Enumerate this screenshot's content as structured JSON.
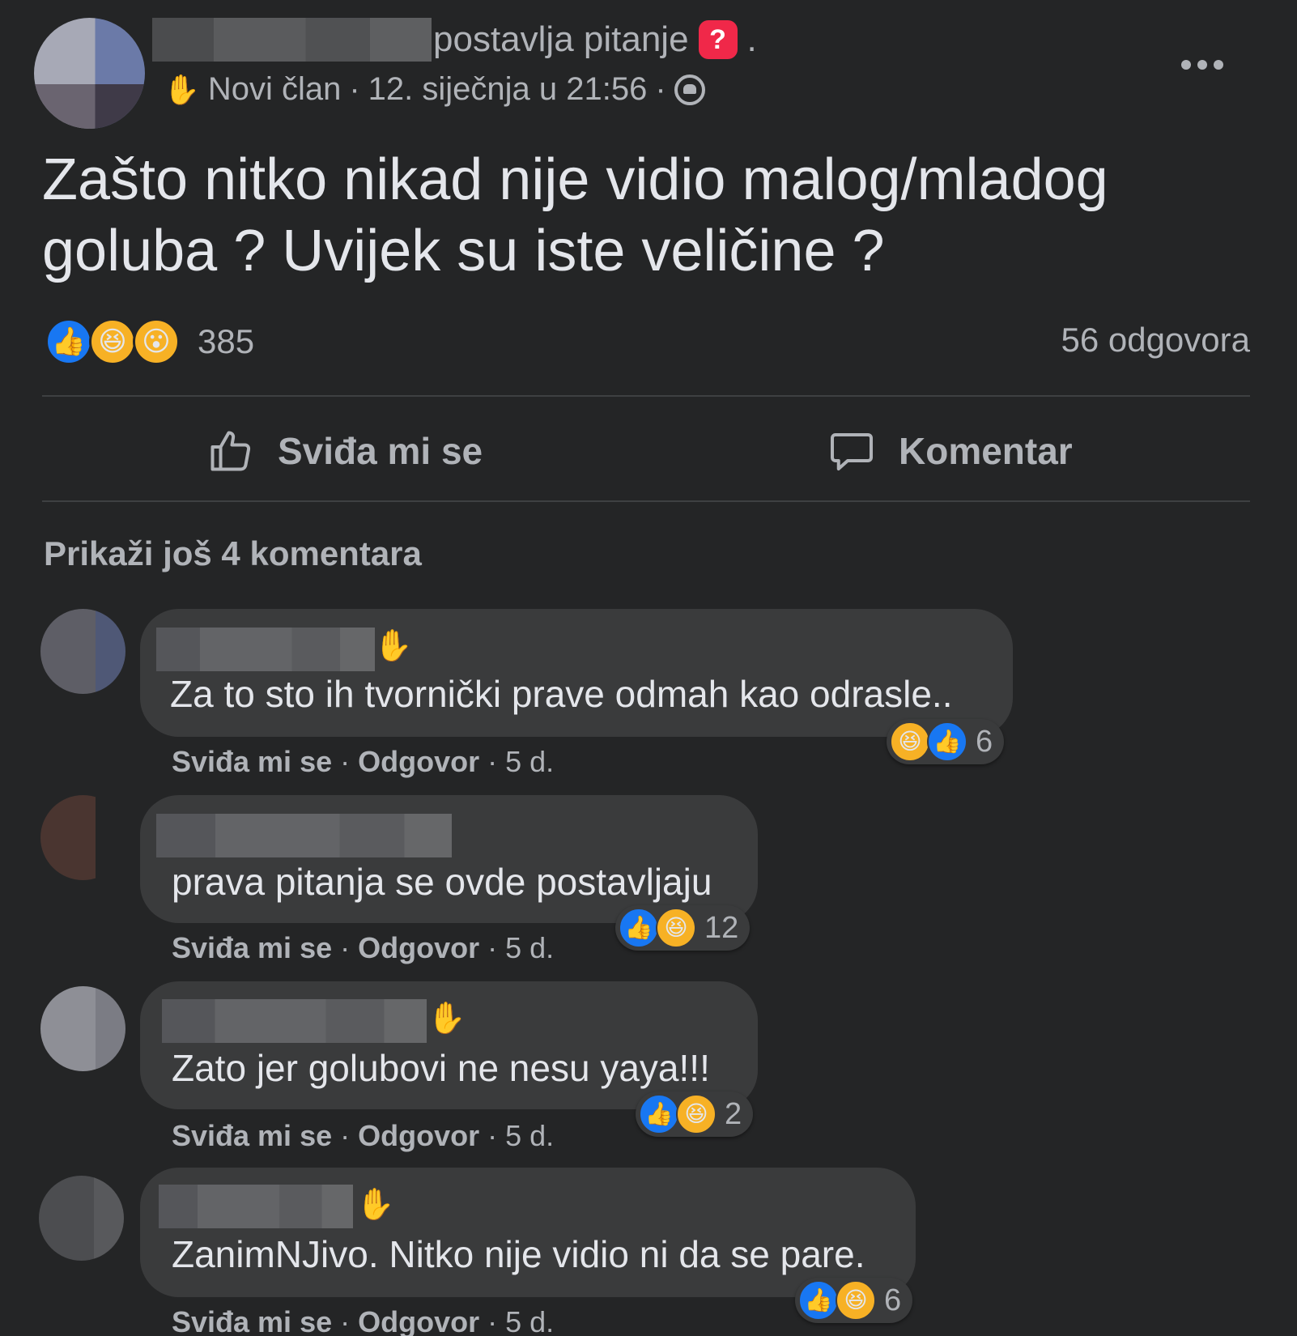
{
  "post": {
    "action_text": "postavlja pitanje",
    "question_icon": "question-icon",
    "trailing_dot": ".",
    "badge": "Novi član",
    "date": "12. siječnja u 21:56",
    "separator": "·",
    "privacy_icon": "group-icon",
    "text": "Zašto nitko nikad nije vidio malog/mladog goluba ? Uvijek su iste veličine ?",
    "reactions": {
      "icons": [
        "like",
        "haha",
        "wow"
      ],
      "count": "385"
    },
    "replies": "56 odgovora",
    "actions": {
      "like_label": "Sviđa mi se",
      "comment_label": "Komentar"
    },
    "more_comments": "Prikaži još 4 komentara"
  },
  "comments": [
    {
      "text": "Za to sto ih tvornički prave odmah kao odrasle..",
      "reactions": [
        "haha",
        "like"
      ],
      "count": "6",
      "like_label": "Sviđa mi se",
      "reply_label": "Odgovor",
      "age": "5 d."
    },
    {
      "text": "prava pitanja se ovde postavljaju",
      "reactions": [
        "like",
        "haha"
      ],
      "count": "12",
      "like_label": "Sviđa mi se",
      "reply_label": "Odgovor",
      "age": "5 d."
    },
    {
      "text": "Zato jer golubovi ne nesu yaya!!!",
      "reactions": [
        "like",
        "haha"
      ],
      "count": "2",
      "like_label": "Sviđa mi se",
      "reply_label": "Odgovor",
      "age": "5 d."
    },
    {
      "text": "ZanimNJivo. Nitko nije vidio ni da se pare.",
      "reactions": [
        "like",
        "haha"
      ],
      "count": "6",
      "like_label": "Sviđa mi se",
      "reply_label": "Odgovor",
      "age": "5 d."
    }
  ],
  "colors": {
    "background": "#242526",
    "bubble": "#3a3b3c",
    "text": "#e4e6eb",
    "secondary": "#b0b3b8",
    "like_blue": "#1877f2",
    "haha_yellow": "#f7b125",
    "question_red": "#f02849"
  }
}
